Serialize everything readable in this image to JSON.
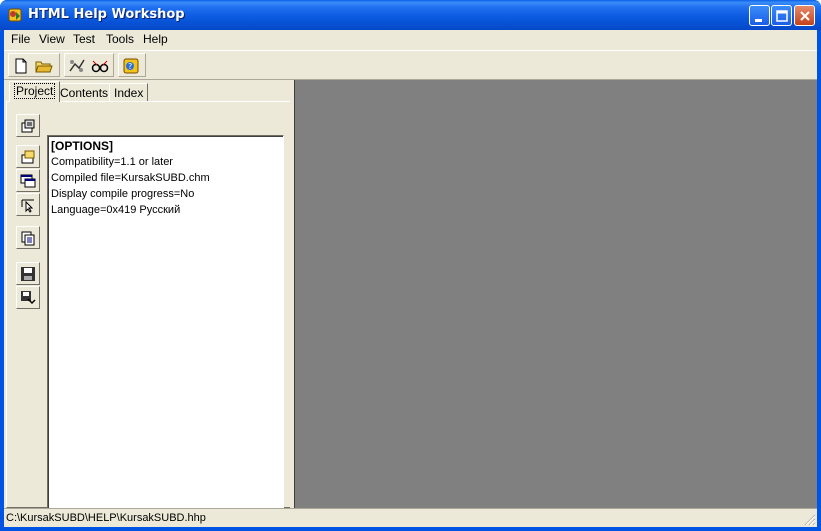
{
  "window": {
    "title": "HTML Help Workshop"
  },
  "menu": [
    {
      "label": "File"
    },
    {
      "label": "View"
    },
    {
      "label": "Test"
    },
    {
      "label": "Tools"
    },
    {
      "label": "Help"
    }
  ],
  "toolbar": {
    "buttons": [
      {
        "icon": "new-file-icon"
      },
      {
        "icon": "open-folder-icon"
      },
      {
        "icon": "compile-icon"
      },
      {
        "icon": "view-compiled-icon"
      },
      {
        "icon": "help-icon"
      }
    ]
  },
  "tabs": [
    {
      "label": "Project",
      "active": true
    },
    {
      "label": "Contents",
      "active": false
    },
    {
      "label": "Index",
      "active": false
    }
  ],
  "side_buttons": [
    {
      "icon": "change-options-icon"
    },
    {
      "icon": "add-remove-files-icon"
    },
    {
      "icon": "add-modify-window-icon"
    },
    {
      "icon": "html-api-icon"
    },
    {
      "icon": "view-html-source-icon"
    },
    {
      "icon": "save-file-icon"
    },
    {
      "icon": "save-compile-icon"
    }
  ],
  "editor": {
    "heading": "[OPTIONS]",
    "lines": [
      "Compatibility=1.1 or later",
      "Compiled file=KursakSUBD.chm",
      "Display compile progress=No",
      "Language=0x419 Русский"
    ]
  },
  "status": {
    "path": "C:\\KursakSUBD\\HELP\\KursakSUBD.hhp"
  },
  "colors": {
    "titlebar": "#0054e3",
    "chrome": "#ece9d8",
    "workspace": "#808080"
  }
}
